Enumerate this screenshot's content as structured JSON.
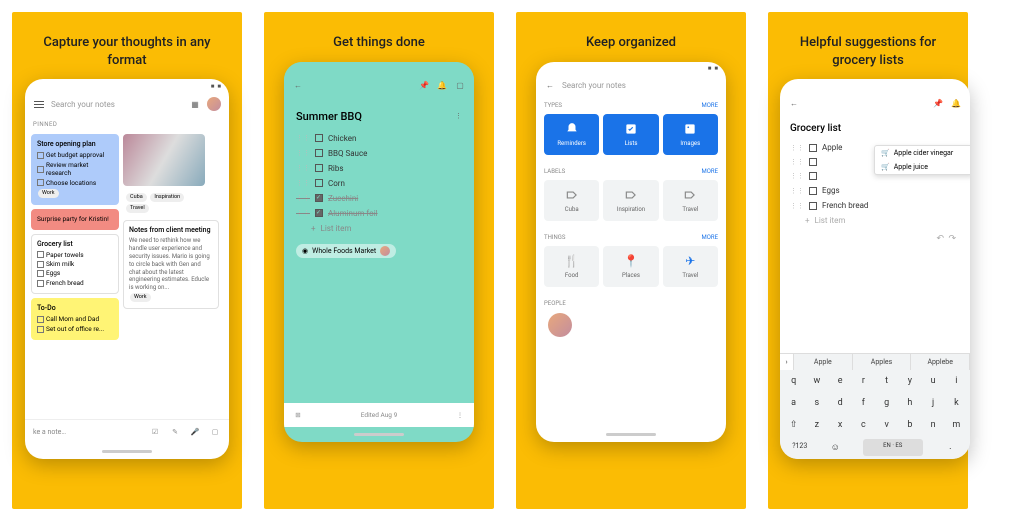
{
  "panels": [
    {
      "headline": "Capture your thoughts in any format"
    },
    {
      "headline": "Get things done"
    },
    {
      "headline": "Keep organized"
    },
    {
      "headline": "Helpful suggestions for grocery lists"
    }
  ],
  "p1": {
    "search": "Search your notes",
    "pinned": "PINNED",
    "storeplan": {
      "title": "Store opening plan",
      "items": [
        "Get budget approval",
        "Review market research",
        "Choose locations"
      ],
      "tag": "Work"
    },
    "imgtags": [
      "Cuba",
      "Inspiration",
      "Travel"
    ],
    "surprise": "Surprise party for Kristin!",
    "grocery": {
      "title": "Grocery list",
      "items": [
        "Paper towels",
        "Skim milk",
        "Eggs",
        "French bread"
      ]
    },
    "clientnotes": {
      "title": "Notes from client meeting",
      "body": "We need to rethink how we handle user experience and security issues. Mario is going to circle back with Gen and chat about the latest engineering estimates. Educle is working on...",
      "tag": "Work"
    },
    "todo": {
      "title": "To-Do",
      "items": [
        "Call Mom and Dad",
        "Set out of office re..."
      ]
    },
    "takenote": "ke a note…"
  },
  "p2": {
    "title": "Summer BBQ",
    "items": [
      "Chicken",
      "BBQ Sauce",
      "Ribs",
      "Corn"
    ],
    "done": [
      "Zucchini",
      "Aluminum foil"
    ],
    "add": "List item",
    "location": "Whole Foods Market",
    "edited": "Edited Aug 9"
  },
  "p3": {
    "search": "Search your notes",
    "types": {
      "label": "TYPES",
      "more": "MORE",
      "tiles": [
        "Reminders",
        "Lists",
        "Images"
      ]
    },
    "labels": {
      "label": "LABELS",
      "more": "MORE",
      "tiles": [
        "Cuba",
        "Inspiration",
        "Travel"
      ]
    },
    "things": {
      "label": "THINGS",
      "more": "MORE",
      "tiles": [
        "Food",
        "Places",
        "Travel"
      ]
    },
    "people": "PEOPLE"
  },
  "p4": {
    "title": "Grocery list",
    "items": [
      "Apple",
      "",
      "",
      "Eggs",
      "French bread"
    ],
    "add": "List item",
    "sugg": [
      "Apple cider vinegar",
      "Apple juice"
    ],
    "sbar": [
      "Apple",
      "Apples",
      "Applebe"
    ],
    "rows": [
      [
        "q",
        "w",
        "e",
        "r",
        "t",
        "y",
        "u",
        "i"
      ],
      [
        "a",
        "s",
        "d",
        "f",
        "g",
        "h",
        "j",
        "k"
      ],
      [
        "z",
        "x",
        "c",
        "v",
        "b",
        "n",
        "m"
      ]
    ],
    "lang": "EN · ES"
  }
}
